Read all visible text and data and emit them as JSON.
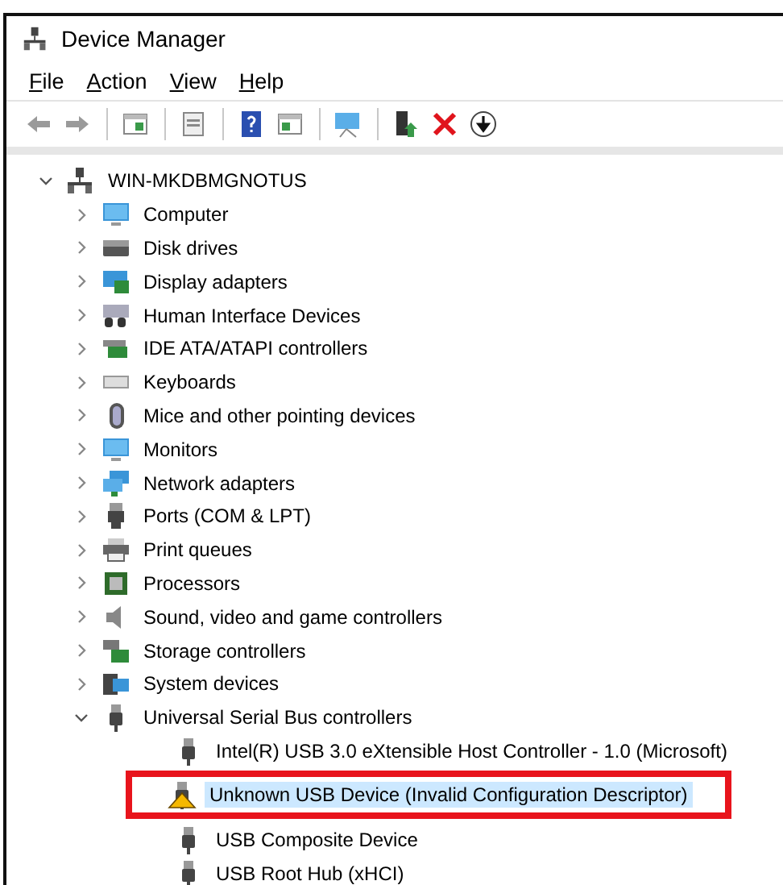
{
  "window": {
    "title": "Device Manager"
  },
  "menu": [
    {
      "label": "File"
    },
    {
      "label": "Action"
    },
    {
      "label": "View"
    },
    {
      "label": "Help"
    }
  ],
  "toolbar": [
    {
      "kind": "back"
    },
    {
      "kind": "forward"
    },
    {
      "kind": "pane"
    },
    {
      "kind": "properties"
    },
    {
      "kind": "help"
    },
    {
      "kind": "pane-right"
    },
    {
      "kind": "scan"
    },
    {
      "kind": "update"
    },
    {
      "kind": "uninstall"
    },
    {
      "kind": "download"
    }
  ],
  "tree": {
    "label": "WIN-MKDBMGNOTUS",
    "kind": "network",
    "expanded": true,
    "children": [
      {
        "label": "Computer",
        "kind": "monitor",
        "expanded": false
      },
      {
        "label": "Disk drives",
        "kind": "disk",
        "expanded": false
      },
      {
        "label": "Display adapters",
        "kind": "display",
        "expanded": false
      },
      {
        "label": "Human Interface Devices",
        "kind": "hid",
        "expanded": false
      },
      {
        "label": "IDE ATA/ATAPI controllers",
        "kind": "card",
        "expanded": false
      },
      {
        "label": "Keyboards",
        "kind": "keyboard",
        "expanded": false
      },
      {
        "label": "Mice and other pointing devices",
        "kind": "mouse",
        "expanded": false
      },
      {
        "label": "Monitors",
        "kind": "monitor",
        "expanded": false
      },
      {
        "label": "Network adapters",
        "kind": "network-adapter",
        "expanded": false
      },
      {
        "label": "Ports (COM & LPT)",
        "kind": "port",
        "expanded": false
      },
      {
        "label": "Print queues",
        "kind": "printer",
        "expanded": false
      },
      {
        "label": "Processors",
        "kind": "chip",
        "expanded": false
      },
      {
        "label": "Sound, video and game controllers",
        "kind": "speaker",
        "expanded": false
      },
      {
        "label": "Storage controllers",
        "kind": "storage",
        "expanded": false
      },
      {
        "label": "System devices",
        "kind": "system",
        "expanded": false
      },
      {
        "label": "Universal Serial Bus controllers",
        "kind": "usb",
        "expanded": true,
        "children": [
          {
            "label": "Intel(R) USB 3.0 eXtensible Host Controller - 1.0 (Microsoft)",
            "kind": "usb",
            "warning": false,
            "selected": false,
            "highlighted": false
          },
          {
            "label": "Unknown USB Device (Invalid Configuration Descriptor)",
            "kind": "usb",
            "warning": true,
            "selected": true,
            "highlighted": true
          },
          {
            "label": "USB Composite Device",
            "kind": "usb",
            "warning": false,
            "selected": false,
            "highlighted": false
          },
          {
            "label": "USB Root Hub (xHCI)",
            "kind": "usb",
            "warning": false,
            "selected": false,
            "highlighted": false
          }
        ]
      }
    ]
  }
}
